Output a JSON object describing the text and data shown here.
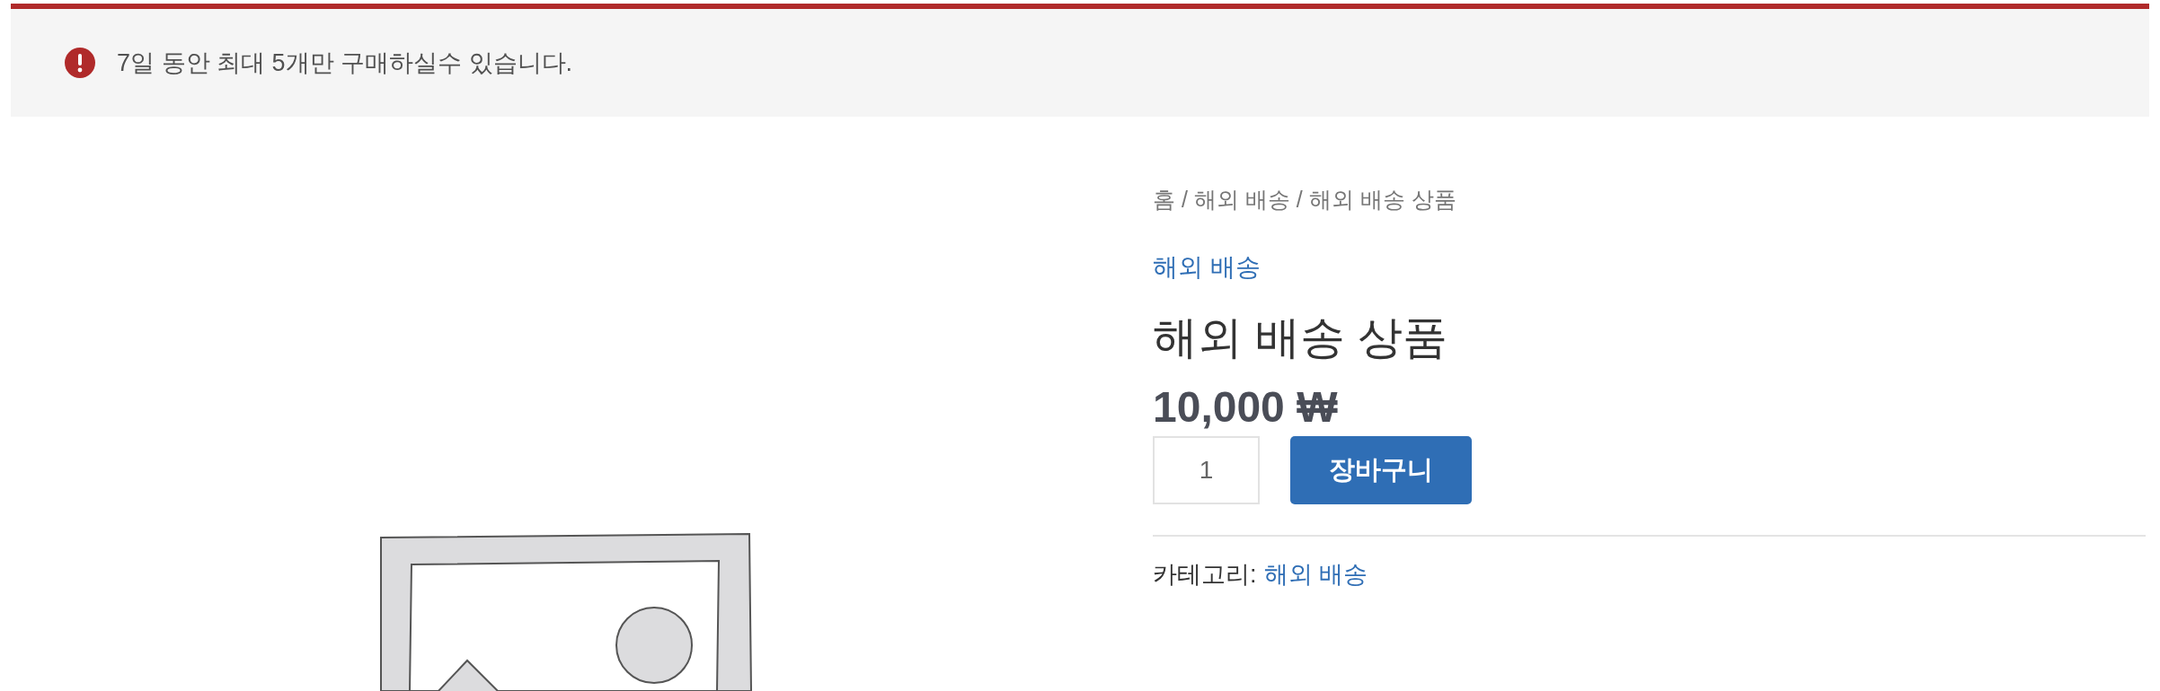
{
  "notice": {
    "kind": "error",
    "message": "7일 동안 최대 5개만 구매하실수 있습니다."
  },
  "product": {
    "breadcrumb": "홈 / 해외 배송 / 해외 배송 상품",
    "category_link": "해외 배송",
    "title": "해외 배송 상품",
    "price": "10,000 ₩",
    "quantity": "1",
    "add_to_cart": "장바구니",
    "meta_label": "카테고리:",
    "meta_category": "해외 배송"
  }
}
